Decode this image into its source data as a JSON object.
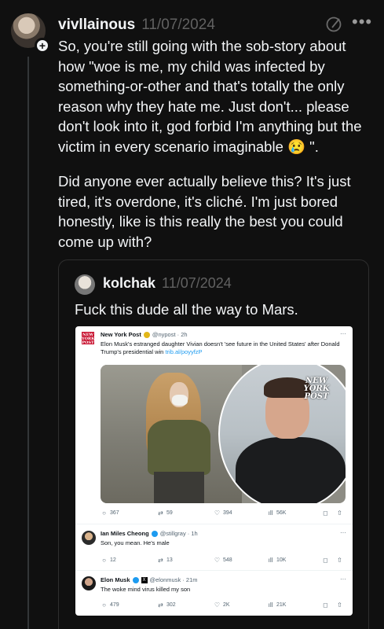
{
  "post": {
    "username": "vivllainous",
    "date": "11/07/2024",
    "paragraph1": "So, you're still going with the sob-story about how \"woe is me, my child was infected by something-or-other and that's totally the only reason why they hate me. Just don't... please don't look into it, god forbid I'm anything but the victim in every scenario imaginable 😢 \".",
    "paragraph2": "Did anyone ever actually believe this? It's just tired, it's overdone, it's cliché. I'm just bored honestly, like is this really the best you could come up with?",
    "icons": [
      "avatar",
      "follow-plus-icon",
      "compose-icon",
      "more-icon"
    ]
  },
  "quote": {
    "username": "kolchak",
    "date": "11/07/2024",
    "text": "Fuck this dude all the way to Mars."
  },
  "screenshot": {
    "tweet": {
      "logo_text": "NEW YORK POST",
      "name": "New York Post",
      "handle": "@nypost · 2h",
      "text": "Elon Musk's estranged daughter Vivian doesn't 'see future in the United States' after Donald Trump's presidential win",
      "link": "trib.al/poyyfzP",
      "photo_badge": "NEW YORK POST",
      "replies": "367",
      "reposts": "59",
      "likes": "394",
      "views": "56K"
    },
    "reply1": {
      "name": "Ian Miles Cheong",
      "handle": "@stillgray · 1h",
      "text": "Son, you mean. He's male",
      "replies": "12",
      "reposts": "13",
      "likes": "548",
      "views": "10K"
    },
    "reply2": {
      "name": "Elon Musk",
      "handle": "@elonmusk · 21m",
      "text": "The woke mind virus killed my son",
      "replies": "479",
      "reposts": "302",
      "likes": "2K",
      "views": "21K"
    }
  }
}
